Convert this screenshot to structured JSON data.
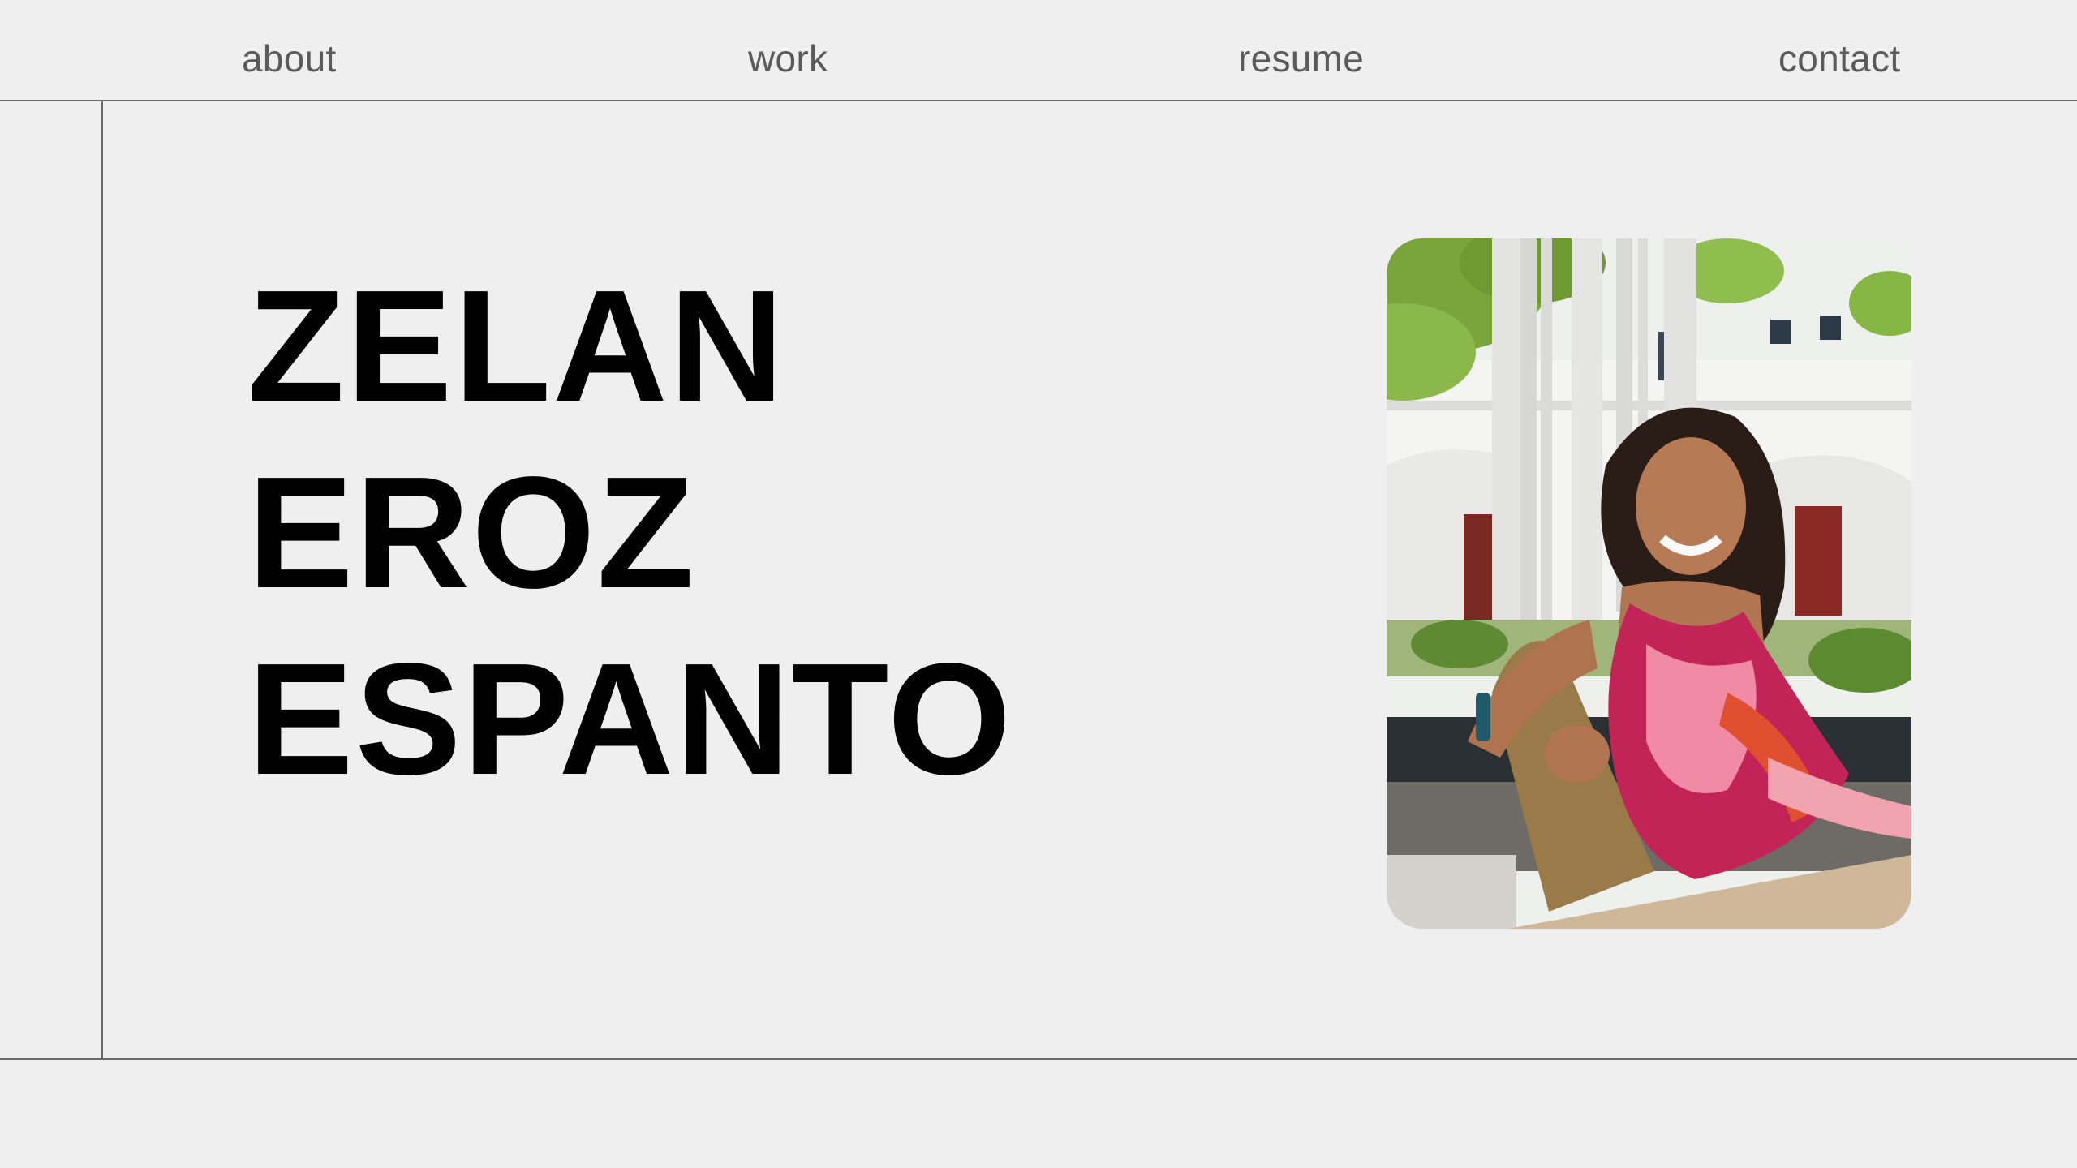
{
  "nav": {
    "about": "about",
    "work": "work",
    "resume": "resume",
    "contact": "contact"
  },
  "hero": {
    "name_line1": "ZELAN",
    "name_line2": "EROZ",
    "name_line3": "ESPANTO"
  },
  "colors": {
    "background": "#efefef",
    "nav_text": "#5b5b5b",
    "heading": "#000000",
    "rule": "#6a6a6a"
  }
}
